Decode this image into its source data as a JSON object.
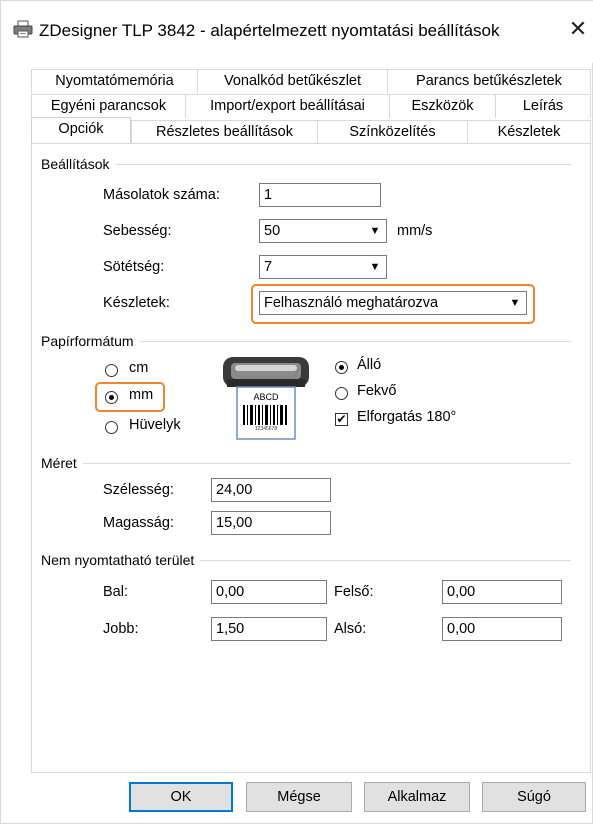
{
  "window": {
    "title": "ZDesigner TLP 3842 - alapértelmezett nyomtatási beállítások",
    "printer_icon": "printer-icon",
    "close_glyph": "✕"
  },
  "tabs": {
    "row1": [
      "Nyomtatómemória",
      "Vonalkód betűkészlet",
      "Parancs betűkészletek"
    ],
    "row2": [
      "Egyéni parancsok",
      "Import/export beállításai",
      "Eszközök",
      "Leírás"
    ],
    "row3": [
      "Opciók",
      "Részletes beállítások",
      "Színközelítés",
      "Készletek"
    ],
    "active": "Opciók"
  },
  "settings": {
    "group_label": "Beállítások",
    "copies_label": "Másolatok száma:",
    "copies_value": "1",
    "speed_label": "Sebesség:",
    "speed_value": "50",
    "speed_unit": "mm/s",
    "darkness_label": "Sötétség:",
    "darkness_value": "7",
    "stocks_label": "Készletek:",
    "stocks_value": "Felhasználó meghatározva"
  },
  "paper_format": {
    "group_label": "Papírformátum",
    "units": [
      {
        "label": "cm",
        "selected": false
      },
      {
        "label": "mm",
        "selected": true
      },
      {
        "label": "Hüvelyk",
        "selected": false
      }
    ],
    "label_preview": {
      "text": "ABCD",
      "barcode_digits": "12345678"
    },
    "orientation": [
      {
        "label": "Álló",
        "selected": true
      },
      {
        "label": "Fekvő",
        "selected": false
      }
    ],
    "rotate_label": "Elforgatás 180°",
    "rotate_checked": true
  },
  "size": {
    "group_label": "Méret",
    "width_label": "Szélesség:",
    "width_value": "24,00",
    "height_label": "Magasság:",
    "height_value": "15,00"
  },
  "unprintable": {
    "group_label": "Nem nyomtatható terület",
    "left_label": "Bal:",
    "left_value": "0,00",
    "top_label": "Felső:",
    "top_value": "0,00",
    "right_label": "Jobb:",
    "right_value": "1,50",
    "bottom_label": "Alsó:",
    "bottom_value": "0,00"
  },
  "buttons": {
    "ok": "OK",
    "cancel": "Mégse",
    "apply": "Alkalmaz",
    "help": "Súgó"
  },
  "colors": {
    "highlight": "#ee8533",
    "default_button_border": "#0078d7"
  }
}
